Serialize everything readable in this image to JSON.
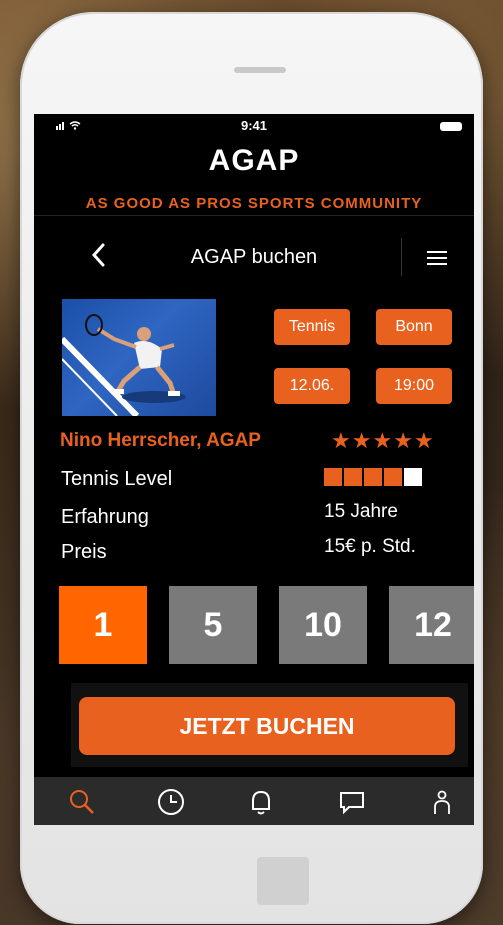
{
  "status": {
    "time": "9:41"
  },
  "header": {
    "brand": "AGAP",
    "tagline": "AS GOOD AS PROS SPORTS COMMUNITY"
  },
  "nav": {
    "title": "AGAP buchen"
  },
  "chips": {
    "sport": "Tennis",
    "city": "Bonn",
    "date": "12.06.",
    "time": "19:00"
  },
  "coach": {
    "name": "Nino Herrscher, AGAP",
    "rating": 5
  },
  "details": {
    "level_label": "Tennis Level",
    "level_value": 4,
    "level_max": 5,
    "experience_label": "Erfahrung",
    "experience_value": "15 Jahre",
    "price_label": "Preis",
    "price_value": "15€ p. Std."
  },
  "packages": [
    {
      "label": "1",
      "selected": true
    },
    {
      "label": "5",
      "selected": false
    },
    {
      "label": "10",
      "selected": false
    },
    {
      "label": "12",
      "selected": false
    }
  ],
  "cta": {
    "label": "JETZT BUCHEN"
  },
  "tabs": [
    {
      "icon": "search-icon",
      "active": true
    },
    {
      "icon": "clock-icon",
      "active": false
    },
    {
      "icon": "bell-icon",
      "active": false
    },
    {
      "icon": "chat-icon",
      "active": false
    },
    {
      "icon": "person-icon",
      "active": false
    }
  ],
  "colors": {
    "accent": "#e9611e",
    "selected": "#ff6600",
    "unselected": "#7a7a7a"
  }
}
